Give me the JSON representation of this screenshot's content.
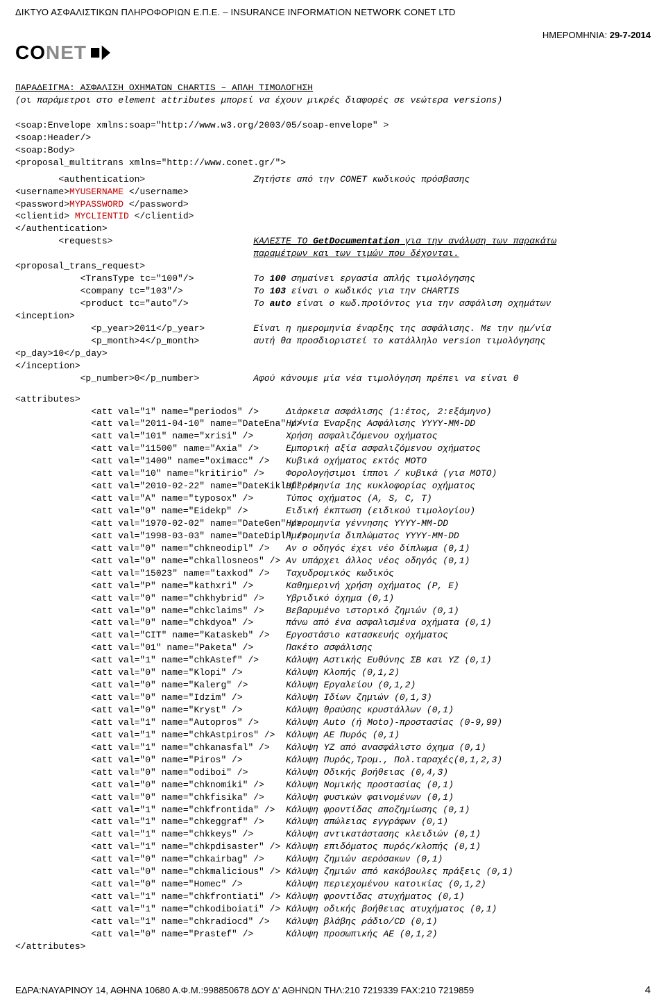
{
  "header": {
    "org_line": "ΔΙΚΤΥΟ ΑΣΦΑΛΙΣΤΙΚΩΝ ΠΛΗΡΟΦΟΡΙΩΝ Ε.Π.Ε. – INSURANCE INFORMATION NETWORK CONET LTD",
    "date_label": "ΗΜΕΡΟΜΗΝΙΑ:  ",
    "date_value": "29-7-2014",
    "logo_text_black": "CO",
    "logo_text_gray": "NET"
  },
  "title": {
    "line1": "ΠΑΡΑΔΕΙΓΜΑ: ΑΣΦΑΛΙΣΗ ΟΧΗΜΑΤΩΝ CHARTIS – ΑΠΛΗ ΤΙΜΟΛΟΓΗΣΗ",
    "line2": "(οι παράμετροι στο element attributes μπορεί να έχουν μικρές διαφορές σε νεώτερα versions)"
  },
  "code": {
    "env_open": "<soap:Envelope xmlns:soap=\"http://www.w3.org/2003/05/soap-envelope\" >",
    "header": "  <soap:Header/>",
    "body_open": "  <soap:Body>",
    "proposal_open": "    <proposal_multitrans xmlns=\"http://www.conet.gr/\">",
    "auth_open": "        <authentication>",
    "auth_comment": "Ζητήστε από την CONET κωδικούς πρόσβασης",
    "username_open": "          <username>",
    "username_val": "MYUSERNAME ",
    "username_close": "</username>",
    "password_open": "          <password>",
    "password_val": "MYPASSWORD ",
    "password_close": "</password>",
    "clientid_open": "          <clientid> ",
    "clientid_val": "MYCLIENTID ",
    "clientid_close": "</clientid>",
    "auth_close": "        </authentication>",
    "requests_open": "        <requests>",
    "requests_c1a": "ΚΑΛΕΣΤΕ ΤΟ ",
    "requests_c1b": "GetDocumentation",
    "requests_c1c": " για την ανάλυση των παρακάτω",
    "requests_c2": "παραμέτρων και των τιμών που δέχονται.",
    "ptr_open": "          <proposal_trans_request>",
    "tt": "            <TransType tc=\"100\"/>",
    "tt_c_a": "Το ",
    "tt_c_b": "100",
    "tt_c_c": " σημαίνει εργασία απλής τιμολόγησης",
    "comp": "            <company tc=\"103\"/>",
    "comp_c_a": "Το ",
    "comp_c_b": "103",
    "comp_c_c": " είναι ο κωδικός για την CHARTIS",
    "prod": "            <product tc=\"auto\"/>",
    "prod_c_a": "Το ",
    "prod_c_b": "auto",
    "prod_c_c": " είναι ο κωδ.προϊόντος για την ασφάλιση οχημάτων",
    "inc_open": "            <inception>",
    "py": "              <p_year>2011</p_year>",
    "py_c": "Είναι η ημερομηνία έναρξης της ασφάλισης. Με την ημ/νία",
    "pm": "              <p_month>4</p_month>",
    "pm_c": "αυτή θα προσδιοριστεί το κατάλληλο version τιμολόγησης",
    "pd": "              <p_day>10</p_day>",
    "inc_close": "            </inception>",
    "pn": "            <p_number>0</p_number>",
    "pn_c": "Αφού κάνουμε μία νέα τιμολόγηση πρέπει να είναι 0",
    "attr_open": "            <attributes>",
    "attrs": [
      {
        "l": "              <att val=\"1\" name=\"periodos\" />",
        "c": "Διάρκεια ασφάλισης (1:έτος, 2:εξάμηνο)"
      },
      {
        "l": "              <att val=\"2011-04-10\" name=\"DateEna\" />",
        "c": "Ημ/νία Έναρξης Ασφάλισης YYYY-MM-DD"
      },
      {
        "l": "              <att val=\"101\" name=\"xrisi\" />",
        "c": "Χρήση ασφαλιζόμενου οχήματος"
      },
      {
        "l": "              <att val=\"11500\" name=\"Axia\" />",
        "c": "Εμπορική αξία ασφαλιζόμενου οχήματος"
      },
      {
        "l": "              <att val=\"1400\" name=\"oximacc\" />",
        "c": "Κυβικά οχήματος εκτός ΜΟΤΟ"
      },
      {
        "l": "              <att val=\"10\" name=\"kritirio\" />",
        "c": "Φορολογήσιμοι ίπποι / κυβικά (για ΜΟΤΟ)"
      },
      {
        "l": "              <att val=\"2010-02-22\" name=\"DateKiklof\" />",
        "c": "Ημερομηνία 1ης κυκλοφορίας οχήματος"
      },
      {
        "l": "              <att val=\"A\" name=\"typosox\" />",
        "c": "Τύπος οχήματος (A, S, C, T)"
      },
      {
        "l": "              <att val=\"0\" name=\"Eidekp\" />",
        "c": "Ειδική έκπτωση (ειδικού τιμολογίου)"
      },
      {
        "l": "              <att val=\"1970-02-02\" name=\"DateGen\" />",
        "c": "Ημερομηνία γέννησης YYYY-MM-DD"
      },
      {
        "l": "              <att val=\"1998-03-03\" name=\"DateDipl\" />",
        "c": "Ημερομηνία διπλώματος YYYY-MM-DD"
      },
      {
        "l": "              <att val=\"0\" name=\"chkneodipl\" />",
        "c": "Αν ο οδηγός έχει νέο δίπλωμα (0,1)"
      },
      {
        "l": "              <att val=\"0\" name=\"chkallosneos\" />",
        "c": "Αν υπάρχει άλλος νέος οδηγός (0,1)"
      },
      {
        "l": "              <att val=\"15023\" name=\"taxkod\" />",
        "c": "Ταχυδρομικός κωδικός"
      },
      {
        "l": "              <att val=\"P\" name=\"kathxri\" />",
        "c": "Καθημερινή χρήση οχήματος (P, E)"
      },
      {
        "l": "              <att val=\"0\" name=\"chkhybrid\" />",
        "c": "Υβριδικό όχημα (0,1)"
      },
      {
        "l": "              <att val=\"0\" name=\"chkclaims\" />",
        "c": "Βεβαρυμένο ιστορικό ζημιών (0,1)"
      },
      {
        "l": "              <att val=\"0\" name=\"chkdyoa\" />",
        "c": "πάνω από ένα ασφαλισμένα οχήματα (0,1)"
      },
      {
        "l": "              <att val=\"CIT\" name=\"Kataskeb\" />",
        "c": "Εργοστάσιο κατασκευής οχήματος"
      },
      {
        "l": "              <att val=\"01\" name=\"Paketa\" />",
        "c": "Πακέτο ασφάλισης"
      },
      {
        "l": "              <att val=\"1\" name=\"chkAstef\" />",
        "c": "Κάλυψη Αστικής Ευθύνης ΣΒ και ΥΖ (0,1)"
      },
      {
        "l": "              <att val=\"0\" name=\"Klopi\" />",
        "c": "Κάλυψη Κλοπής (0,1,2)"
      },
      {
        "l": "              <att val=\"0\" name=\"Kalerg\" />",
        "c": "Κάλυψη Εργαλείου (0,1,2)"
      },
      {
        "l": "              <att val=\"0\" name=\"Idzim\" />",
        "c": "Κάλυψη Ιδίων ζημιών (0,1,3)"
      },
      {
        "l": "              <att val=\"0\" name=\"Kryst\" />",
        "c": "Κάλυψη θραύσης κρυστάλλων (0,1)"
      },
      {
        "l": "              <att val=\"1\" name=\"Autopros\" />",
        "c": "Κάλυψη Auto (ή Μoto)-προστασίας (0-9,99)"
      },
      {
        "l": "              <att val=\"1\" name=\"chkAstpiros\" />",
        "c": "Κάλυψη ΑΕ Πυρός (0,1)"
      },
      {
        "l": "              <att val=\"1\" name=\"chkanasfal\" />",
        "c": "Κάλυψη ΥΖ από ανασφάλιστο όχημα (0,1)"
      },
      {
        "l": "              <att val=\"0\" name=\"Piros\" />",
        "c": "Κάλυψη Πυρός,Τρομ., Πολ.ταραχές(0,1,2,3)"
      },
      {
        "l": "              <att val=\"0\" name=\"odiboi\" />",
        "c": "Κάλυψη Οδικής βοήθειας (0,4,3)"
      },
      {
        "l": "              <att val=\"0\" name=\"chknomiki\" />",
        "c": "Κάλυψη Νομικής προστασίας (0,1)"
      },
      {
        "l": "              <att val=\"0\" name=\"chkfisika\" />",
        "c": "Κάλυψη φυσικών φαινομένων (0,1)"
      },
      {
        "l": "              <att val=\"1\" name=\"chkfrontida\" />",
        "c": "Κάλυψη φροντίδας αποζημίωσης (0,1)"
      },
      {
        "l": "              <att val=\"1\" name=\"chkeggraf\" />",
        "c": "Κάλυψη απώλειας εγγράφων (0,1)"
      },
      {
        "l": "              <att val=\"1\" name=\"chkkeys\" />",
        "c": "Κάλυψη αντικατάστασης κλειδιών (0,1)"
      },
      {
        "l": "              <att val=\"1\" name=\"chkpdisaster\" />",
        "c": "Κάλυψη επιδόματος πυρός/κλοπής (0,1)"
      },
      {
        "l": "              <att val=\"0\" name=\"chkairbag\" />",
        "c": "Κάλυψη ζημιών αερόσακων (0,1)"
      },
      {
        "l": "              <att val=\"0\" name=\"chkmalicious\" />",
        "c": "Κάλυψη ζημιών από κακόβουλες πράξεις (0,1)"
      },
      {
        "l": "              <att val=\"0\" name=\"Homec\" />",
        "c": "Κάλυψη περιεχομένου κατοικίας (0,1,2)"
      },
      {
        "l": "              <att val=\"1\" name=\"chkfrontiati\" />",
        "c": "Κάλυψη φροντίδας ατυχήματος (0,1)"
      },
      {
        "l": "              <att val=\"1\" name=\"chkodiboiati\" />",
        "c": "Κάλυψη οδικής βοήθειας ατυχήματος (0,1)"
      },
      {
        "l": "              <att val=\"1\" name=\"chkradiocd\" />",
        "c": "Κάλυψη βλάβης ράδιο/CD (0,1)"
      },
      {
        "l": "              <att val=\"0\" name=\"Prastef\" />",
        "c": "Κάλυψη προσωπικής ΑΕ (0,1,2)"
      }
    ],
    "attr_close": "            </attributes>"
  },
  "footer": {
    "text": "ΕΔΡΑ:ΝΑΥΑΡΙΝΟΥ 14, ΑΘΗΝΑ 10680 Α.Φ.Μ.:998850678 ΔΟΥ Δ' ΑΘΗΝΩΝ ΤΗΛ:210 7219339 FAX:210 7219859",
    "page": "4"
  }
}
